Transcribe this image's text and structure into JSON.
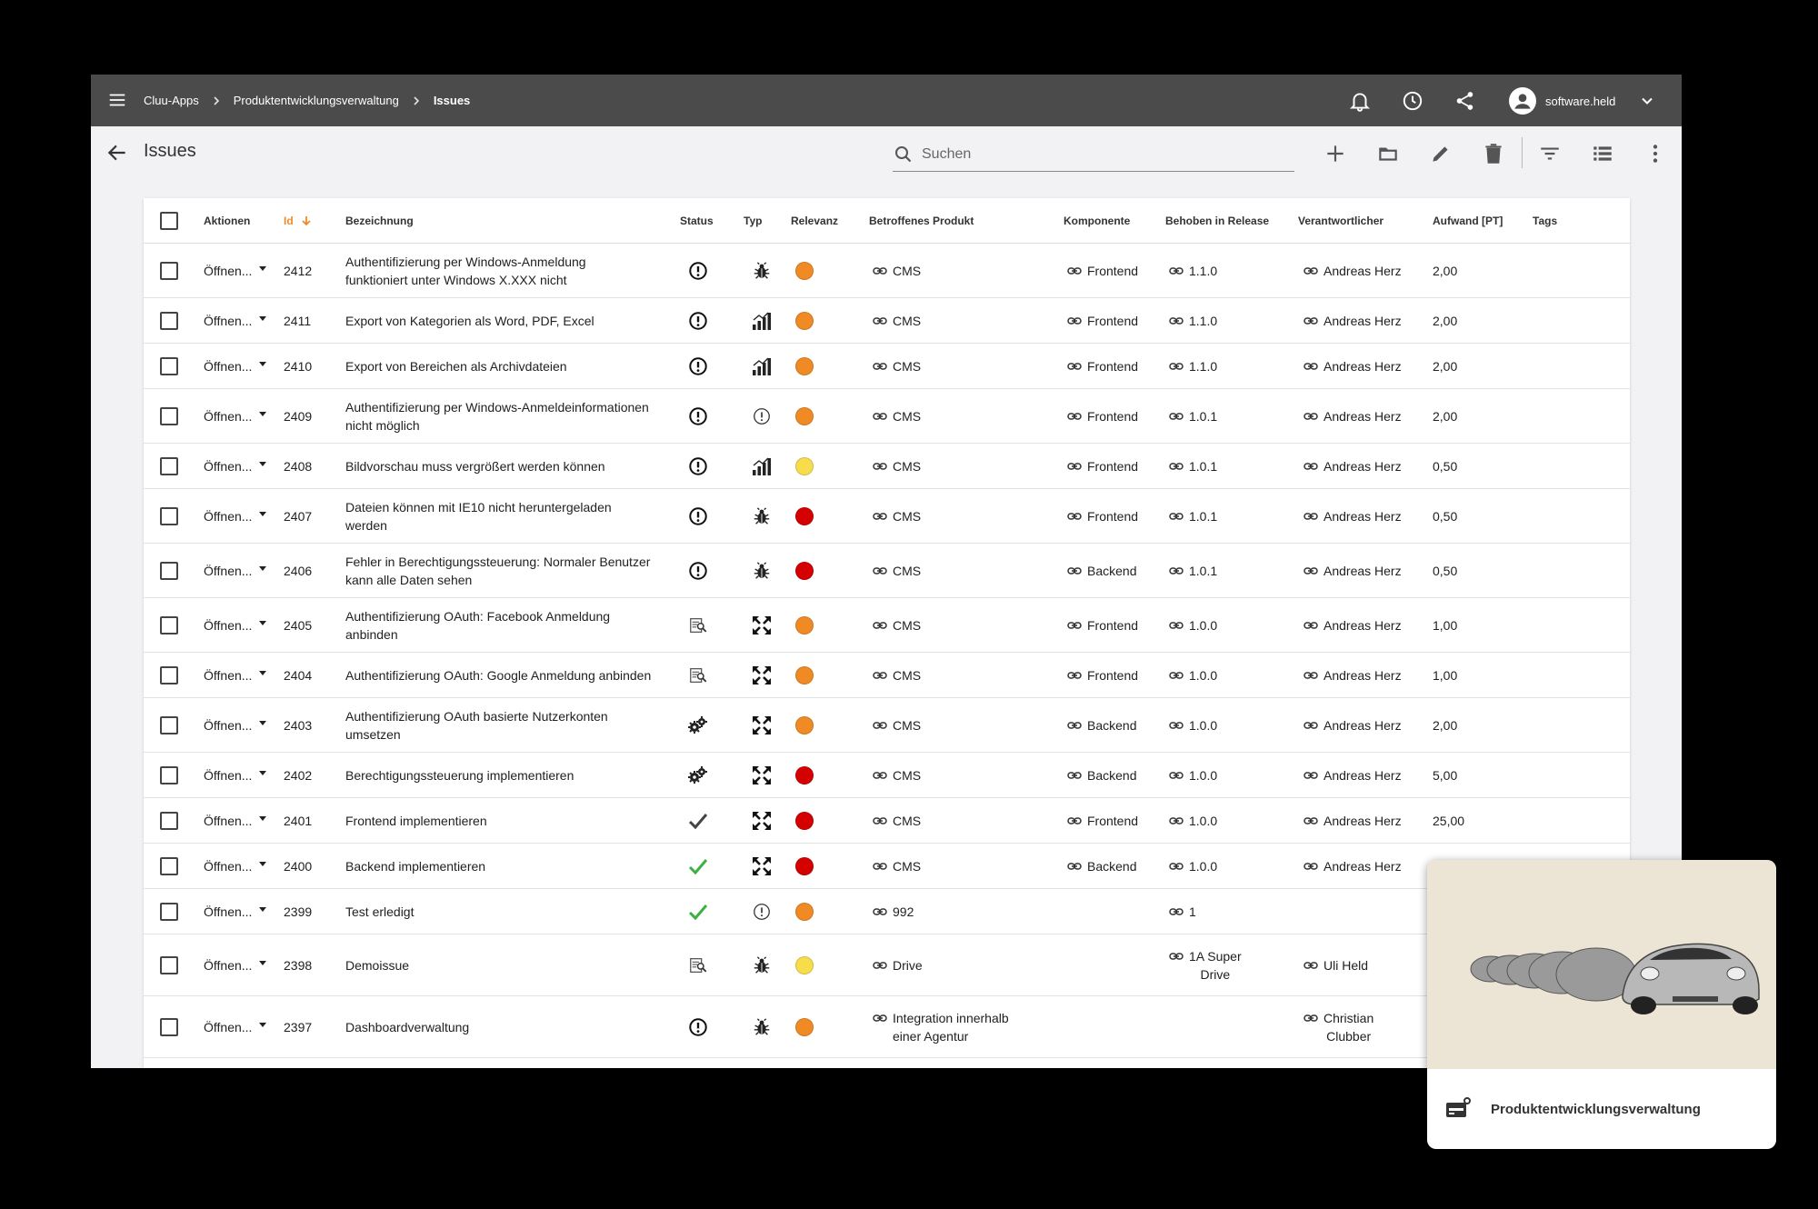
{
  "breadcrumb": [
    "Cluu-Apps",
    "Produktentwicklungsverwaltung",
    "Issues"
  ],
  "user": {
    "name": "software.held"
  },
  "page": {
    "title": "Issues"
  },
  "search": {
    "placeholder": "Suchen"
  },
  "columns": {
    "aktionen": "Aktionen",
    "id": "Id",
    "bezeichnung": "Bezeichnung",
    "status": "Status",
    "typ": "Typ",
    "relevanz": "Relevanz",
    "produkt": "Betroffenes Produkt",
    "komponente": "Komponente",
    "release": "Behoben in Release",
    "verantwortlicher": "Verantwortlicher",
    "aufwand": "Aufwand [PT]",
    "tags": "Tags"
  },
  "colors": {
    "orange": "#f08a24",
    "yellow": "#f7dc4c",
    "red": "#d50000",
    "check_green": "#3cb043",
    "topbar": "#4b4b4b"
  },
  "rows": [
    {
      "aktion": "Öffnen...",
      "id": "2412",
      "bez_lines": [
        "Authentifizierung per Windows-Anmeldung",
        "funktioniert unter Windows X.XXX nicht"
      ],
      "status": "alert-circle-icon",
      "typ": "bug-icon",
      "rel": "orange",
      "produkt_lines": [
        "CMS"
      ],
      "komp": "Frontend",
      "release_lines": [
        "1.1.0"
      ],
      "ver_lines": [
        "Andreas Herz"
      ],
      "aufwand": "2,00"
    },
    {
      "aktion": "Öffnen...",
      "id": "2411",
      "bez_lines": [
        "Export von Kategorien als Word, PDF, Excel"
      ],
      "status": "alert-circle-icon",
      "typ": "signal-bars-icon",
      "rel": "orange",
      "produkt_lines": [
        "CMS"
      ],
      "komp": "Frontend",
      "release_lines": [
        "1.1.0"
      ],
      "ver_lines": [
        "Andreas Herz"
      ],
      "aufwand": "2,00"
    },
    {
      "aktion": "Öffnen...",
      "id": "2410",
      "bez_lines": [
        "Export von Bereichen als Archivdateien"
      ],
      "status": "alert-circle-icon",
      "typ": "signal-bars-icon",
      "rel": "orange",
      "produkt_lines": [
        "CMS"
      ],
      "komp": "Frontend",
      "release_lines": [
        "1.1.0"
      ],
      "ver_lines": [
        "Andreas Herz"
      ],
      "aufwand": "2,00"
    },
    {
      "aktion": "Öffnen...",
      "id": "2409",
      "bez_lines": [
        "Authentifizierung per Windows-Anmeldeinformationen",
        "nicht möglich"
      ],
      "status": "alert-circle-icon",
      "typ": "info-circle-icon",
      "rel": "orange",
      "produkt_lines": [
        "CMS"
      ],
      "komp": "Frontend",
      "release_lines": [
        "1.0.1"
      ],
      "ver_lines": [
        "Andreas Herz"
      ],
      "aufwand": "2,00"
    },
    {
      "aktion": "Öffnen...",
      "id": "2408",
      "bez_lines": [
        "Bildvorschau muss vergrößert werden können"
      ],
      "status": "alert-circle-icon",
      "typ": "signal-bars-icon",
      "rel": "yellow",
      "produkt_lines": [
        "CMS"
      ],
      "komp": "Frontend",
      "release_lines": [
        "1.0.1"
      ],
      "ver_lines": [
        "Andreas Herz"
      ],
      "aufwand": "0,50"
    },
    {
      "aktion": "Öffnen...",
      "id": "2407",
      "bez_lines": [
        "Dateien können mit IE10 nicht heruntergeladen",
        "werden"
      ],
      "status": "alert-circle-icon",
      "typ": "bug-icon",
      "rel": "red",
      "produkt_lines": [
        "CMS"
      ],
      "komp": "Frontend",
      "release_lines": [
        "1.0.1"
      ],
      "ver_lines": [
        "Andreas Herz"
      ],
      "aufwand": "0,50"
    },
    {
      "aktion": "Öffnen...",
      "id": "2406",
      "bez_lines": [
        "Fehler in Berechtigungssteuerung: Normaler Benutzer",
        "kann alle Daten sehen"
      ],
      "status": "alert-circle-icon",
      "typ": "bug-icon",
      "rel": "red",
      "produkt_lines": [
        "CMS"
      ],
      "komp": "Backend",
      "release_lines": [
        "1.0.1"
      ],
      "ver_lines": [
        "Andreas Herz"
      ],
      "aufwand": "0,50"
    },
    {
      "aktion": "Öffnen...",
      "id": "2405",
      "bez_lines": [
        "Authentifizierung OAuth: Facebook Anmeldung",
        "anbinden"
      ],
      "status": "document-search-icon",
      "typ": "expand-arrows-icon",
      "rel": "orange",
      "produkt_lines": [
        "CMS"
      ],
      "komp": "Frontend",
      "release_lines": [
        "1.0.0"
      ],
      "ver_lines": [
        "Andreas Herz"
      ],
      "aufwand": "1,00"
    },
    {
      "aktion": "Öffnen...",
      "id": "2404",
      "bez_lines": [
        "Authentifizierung OAuth: Google Anmeldung anbinden"
      ],
      "status": "document-search-icon",
      "typ": "expand-arrows-icon",
      "rel": "orange",
      "produkt_lines": [
        "CMS"
      ],
      "komp": "Frontend",
      "release_lines": [
        "1.0.0"
      ],
      "ver_lines": [
        "Andreas Herz"
      ],
      "aufwand": "1,00"
    },
    {
      "aktion": "Öffnen...",
      "id": "2403",
      "bez_lines": [
        "Authentifizierung OAuth basierte Nutzerkonten",
        "umsetzen"
      ],
      "status": "gears-icon",
      "typ": "expand-arrows-icon",
      "rel": "orange",
      "produkt_lines": [
        "CMS"
      ],
      "komp": "Backend",
      "release_lines": [
        "1.0.0"
      ],
      "ver_lines": [
        "Andreas Herz"
      ],
      "aufwand": "2,00"
    },
    {
      "aktion": "Öffnen...",
      "id": "2402",
      "bez_lines": [
        "Berechtigungssteuerung implementieren"
      ],
      "status": "gears-icon",
      "typ": "expand-arrows-icon",
      "rel": "red",
      "produkt_lines": [
        "CMS"
      ],
      "komp": "Backend",
      "release_lines": [
        "1.0.0"
      ],
      "ver_lines": [
        "Andreas Herz"
      ],
      "aufwand": "5,00"
    },
    {
      "aktion": "Öffnen...",
      "id": "2401",
      "bez_lines": [
        "Frontend implementieren"
      ],
      "status": "check-dark-icon",
      "typ": "expand-arrows-icon",
      "rel": "red",
      "produkt_lines": [
        "CMS"
      ],
      "komp": "Frontend",
      "release_lines": [
        "1.0.0"
      ],
      "ver_lines": [
        "Andreas Herz"
      ],
      "aufwand": "25,00"
    },
    {
      "aktion": "Öffnen...",
      "id": "2400",
      "bez_lines": [
        "Backend implementieren"
      ],
      "status": "check-green-icon",
      "typ": "expand-arrows-icon",
      "rel": "red",
      "produkt_lines": [
        "CMS"
      ],
      "komp": "Backend",
      "release_lines": [
        "1.0.0"
      ],
      "ver_lines": [
        "Andreas Herz"
      ],
      "aufwand": ""
    },
    {
      "aktion": "Öffnen...",
      "id": "2399",
      "bez_lines": [
        "Test erledigt"
      ],
      "status": "check-green-icon",
      "typ": "info-circle-icon",
      "rel": "orange",
      "produkt_lines": [
        "992"
      ],
      "komp": "",
      "release_lines": [
        "1"
      ],
      "ver_lines": [],
      "aufwand": ""
    },
    {
      "aktion": "Öffnen...",
      "id": "2398",
      "bez_lines": [
        "Demoissue"
      ],
      "status": "document-search-icon",
      "typ": "bug-icon",
      "rel": "yellow",
      "produkt_lines": [
        "Drive"
      ],
      "komp": "",
      "release_lines": [
        "1A Super",
        "Drive"
      ],
      "ver_lines": [
        "Uli Held"
      ],
      "aufwand": ""
    },
    {
      "aktion": "Öffnen...",
      "id": "2397",
      "bez_lines": [
        "Dashboardverwaltung"
      ],
      "status": "alert-circle-icon",
      "typ": "bug-icon",
      "rel": "orange",
      "produkt_lines": [
        "Integration innerhalb",
        "einer Agentur"
      ],
      "komp": "",
      "release_lines": [],
      "ver_lines": [
        "Christian",
        "Clubber"
      ],
      "aufwand": ""
    }
  ],
  "card": {
    "label": "Produktentwicklungsverwaltung"
  }
}
